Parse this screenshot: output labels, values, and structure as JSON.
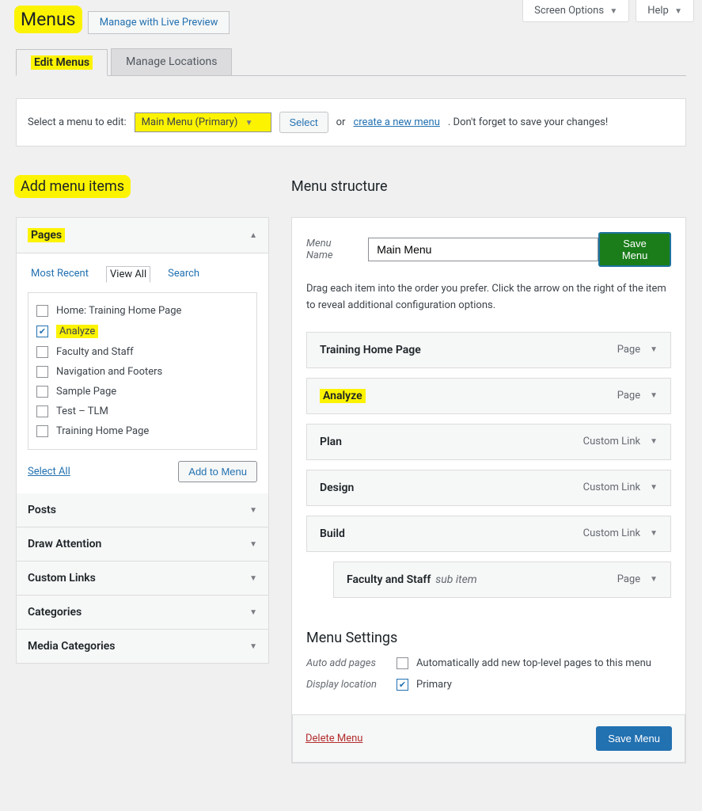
{
  "top": {
    "screen_options": "Screen Options",
    "help": "Help"
  },
  "title": "Menus",
  "preview_button": "Manage with Live Preview",
  "tabs": {
    "edit": "Edit Menus",
    "locations": "Manage Locations"
  },
  "menu_bar": {
    "label": "Select a menu to edit:",
    "selected": "Main Menu (Primary)",
    "select_btn": "Select",
    "or": "or",
    "create_link": "create a new menu",
    "tail": ". Don't forget to save your changes!"
  },
  "left_heading": "Add menu items",
  "pages": {
    "title": "Pages",
    "sub_tabs": {
      "recent": "Most Recent",
      "view_all": "View All",
      "search": "Search"
    },
    "items": [
      {
        "label": "Home: Training Home Page",
        "checked": false
      },
      {
        "label": "Analyze",
        "checked": true,
        "highlight": true
      },
      {
        "label": "Faculty and Staff",
        "checked": false
      },
      {
        "label": "Navigation and Footers",
        "checked": false
      },
      {
        "label": "Sample Page",
        "checked": false
      },
      {
        "label": "Test – TLM",
        "checked": false
      },
      {
        "label": "Training Home Page",
        "checked": false
      }
    ],
    "select_all": "Select All",
    "add_btn": "Add to Menu"
  },
  "closed_boxes": [
    {
      "title": "Posts"
    },
    {
      "title": "Draw Attention"
    },
    {
      "title": "Custom Links"
    },
    {
      "title": "Categories"
    },
    {
      "title": "Media Categories"
    }
  ],
  "right_heading": "Menu structure",
  "menu_name_label": "Menu Name",
  "menu_name_value": "Main Menu",
  "save_btn": "Save Menu",
  "instructions": "Drag each item into the order you prefer. Click the arrow on the right of the item to reveal additional configuration options.",
  "menu_items": [
    {
      "title": "Training Home Page",
      "type": "Page"
    },
    {
      "title": "Analyze",
      "type": "Page",
      "highlight": true
    },
    {
      "title": "Plan",
      "type": "Custom Link"
    },
    {
      "title": "Design",
      "type": "Custom Link"
    },
    {
      "title": "Build",
      "type": "Custom Link"
    },
    {
      "title": "Faculty and Staff",
      "type": "Page",
      "sub": true,
      "sub_label": "sub item"
    }
  ],
  "settings": {
    "heading": "Menu Settings",
    "auto_label": "Auto add pages",
    "auto_text": "Automatically add new top-level pages to this menu",
    "auto_checked": false,
    "loc_label": "Display location",
    "loc_text": "Primary",
    "loc_checked": true
  },
  "footer": {
    "delete": "Delete Menu",
    "save": "Save Menu"
  }
}
